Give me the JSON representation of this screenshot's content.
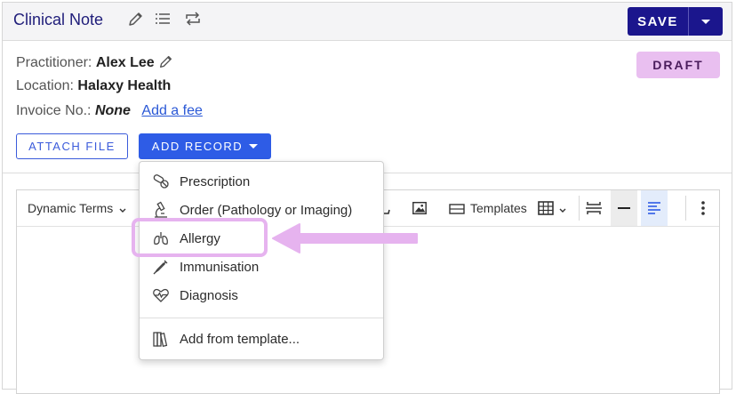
{
  "header": {
    "title": "Clinical Note",
    "save_label": "SAVE",
    "icons": [
      "pencil-icon",
      "list-icon",
      "repeat-icon",
      "chevron-down-icon"
    ]
  },
  "info": {
    "practitioner_label": "Practitioner:",
    "practitioner_value": "Alex Lee",
    "location_label": "Location:",
    "location_value": "Halaxy Health",
    "invoice_label": "Invoice No.:",
    "invoice_value": "None",
    "add_fee_link": "Add a fee",
    "status_badge": "DRAFT"
  },
  "actions": {
    "attach_file": "ATTACH FILE",
    "add_record": "ADD RECORD"
  },
  "toolbar": {
    "dynamic_terms": "Dynamic Terms",
    "templates": "Templates"
  },
  "menu": {
    "items": [
      {
        "label": "Prescription",
        "icon": "pills-icon"
      },
      {
        "label": "Order (Pathology or Imaging)",
        "icon": "microscope-icon"
      },
      {
        "label": "Allergy",
        "icon": "lungs-icon"
      },
      {
        "label": "Immunisation",
        "icon": "syringe-icon"
      },
      {
        "label": "Diagnosis",
        "icon": "heart-pulse-icon"
      }
    ],
    "template_item": {
      "label": "Add from template...",
      "icon": "books-icon"
    }
  },
  "colors": {
    "brand": "#1b168d",
    "primary_button": "#2e5ce6",
    "draft_badge": "#e9bff0",
    "annotation": "#e6b3ef"
  }
}
